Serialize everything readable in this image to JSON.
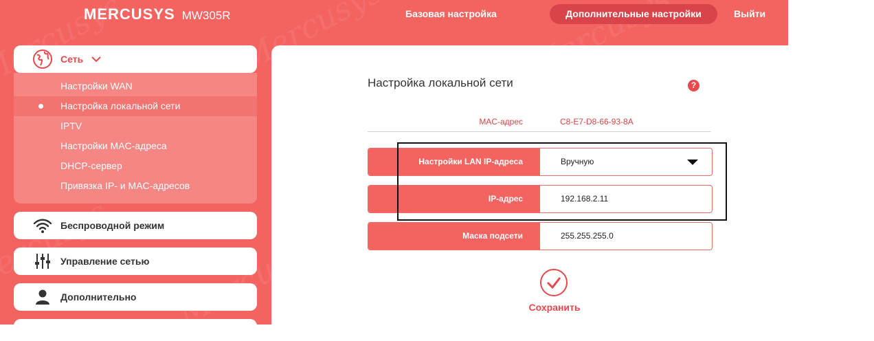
{
  "header": {
    "brand": "MERCUSYS",
    "model": "MW305R",
    "nav_basic": "Базовая настройка",
    "nav_advanced": "Дополнительные настройки",
    "nav_exit": "Выйти",
    "watermark": "Mercusys"
  },
  "sidebar": {
    "network": {
      "label": "Сеть",
      "icon": "globe-icon",
      "items": [
        {
          "label": "Настройки WAN"
        },
        {
          "label": "Настройка локальной сети",
          "active": true
        },
        {
          "label": "IPTV"
        },
        {
          "label": "Настройки MAC-адреса"
        },
        {
          "label": "DHCP-сервер"
        },
        {
          "label": "Привязка IP- и MAC-адресов"
        }
      ]
    },
    "wireless": {
      "label": "Беспроводной режим",
      "icon": "wifi-icon"
    },
    "network_control": {
      "label": "Управление сетью",
      "icon": "sliders-icon"
    },
    "advanced": {
      "label": "Дополнительно",
      "icon": "user-icon"
    }
  },
  "main": {
    "title": "Настройка локальной сети",
    "help": "?",
    "mac": {
      "label": "MAC-адрес",
      "value": "C8-E7-D8-66-93-8A"
    },
    "lan_ip_settings": {
      "label": "Настройки LAN IP-адреса",
      "value": "Вручную"
    },
    "ip_address": {
      "label": "IP-адрес",
      "value": "192.168.2.11"
    },
    "subnet_mask": {
      "label": "Маска подсети",
      "value": "255.255.255.0"
    },
    "save_label": "Сохранить"
  },
  "colors": {
    "brand_bg": "#f36461",
    "accent": "#e7484c",
    "active_nav": "#d9434a",
    "submenu_bg": "#f68684"
  }
}
